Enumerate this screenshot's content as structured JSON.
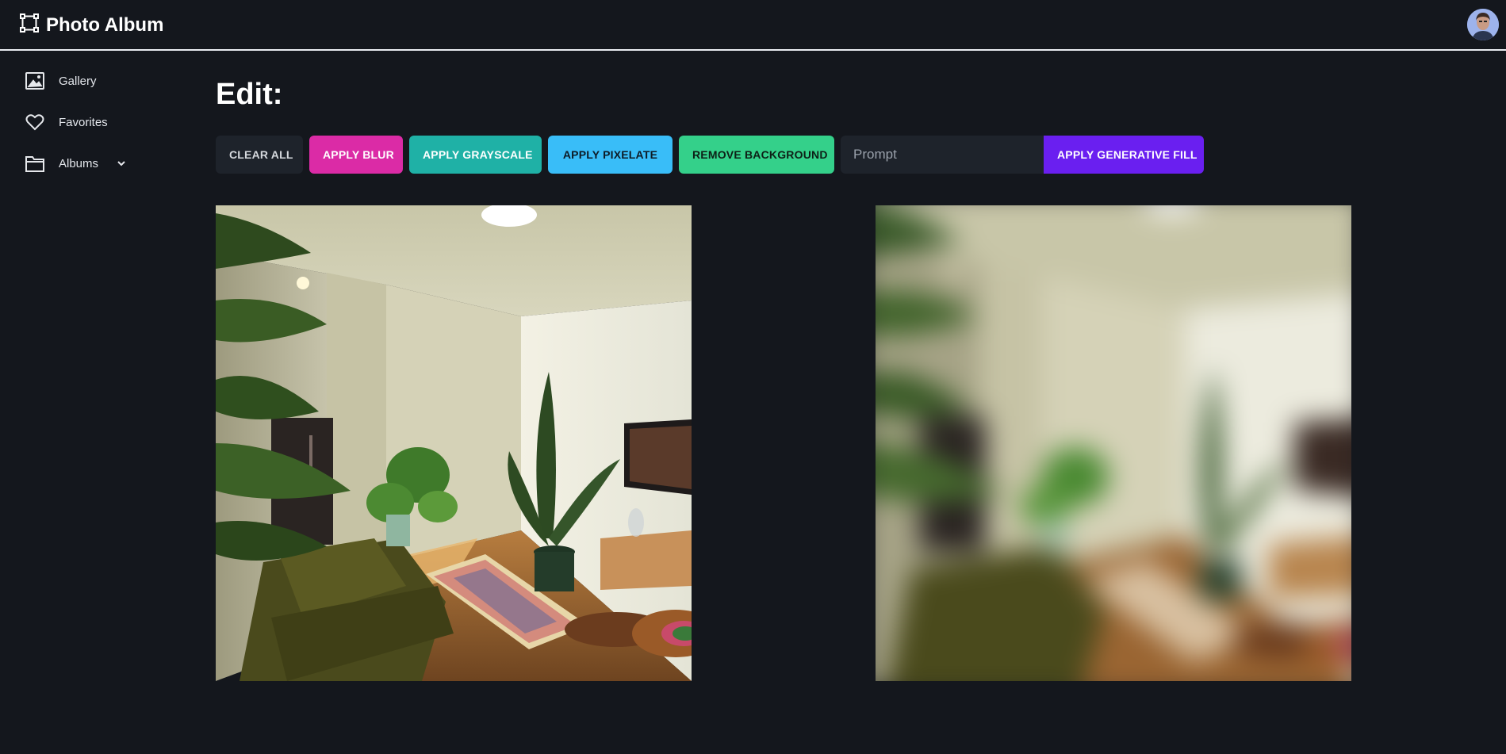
{
  "app": {
    "title": "Photo Album",
    "logo_icon": "crop-frame-icon",
    "avatar_icon": "user-avatar"
  },
  "sidebar": {
    "items": [
      {
        "label": "Gallery",
        "icon": "image-icon"
      },
      {
        "label": "Favorites",
        "icon": "heart-icon"
      },
      {
        "label": "Albums",
        "icon": "folder-icon",
        "expandable": true
      }
    ]
  },
  "editor": {
    "title": "Edit:",
    "buttons": {
      "clear_all": "CLEAR ALL",
      "blur": "APPLY BLUR",
      "grayscale": "APPLY GRAYSCALE",
      "pixelate": "APPLY PIXELATE",
      "remove_background": "REMOVE BACKGROUND",
      "generative_fill": "APPLY GENERATIVE FILL"
    },
    "prompt": {
      "value": "",
      "placeholder": "Prompt"
    },
    "colors": {
      "blur": "#db2ba6",
      "grayscale": "#1fb1a6",
      "pixelate": "#39bdf8",
      "remove_background": "#34d08a",
      "generative_fill": "#6a1ff0"
    },
    "images": [
      {
        "name": "original-photo",
        "effect": "none"
      },
      {
        "name": "edited-photo",
        "effect": "blur"
      }
    ]
  }
}
